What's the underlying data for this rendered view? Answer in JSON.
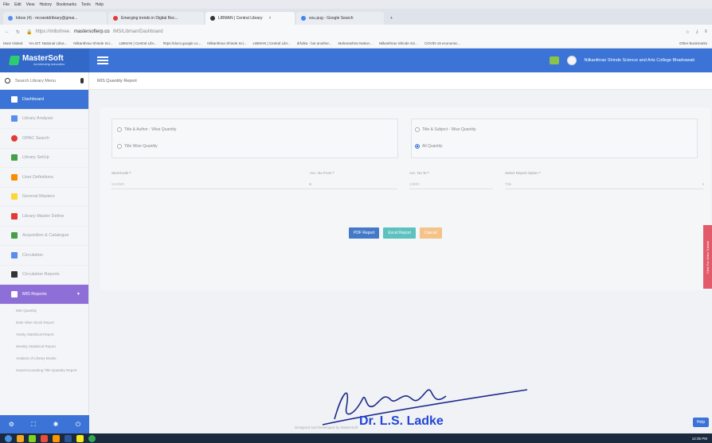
{
  "browser": {
    "menu": [
      "File",
      "Edit",
      "View",
      "History",
      "Bookmarks",
      "Tools",
      "Help"
    ],
    "tabs": [
      {
        "label": "Inbox (4) - mcoestdribrary@gmai...",
        "color": "#5b8def",
        "active": false
      },
      {
        "label": "Emerging trends in Digital Rec...",
        "color": "#e53935",
        "active": false
      },
      {
        "label": "LIBMAN | Central Library",
        "color": "#333333",
        "active": true
      },
      {
        "label": "sou.pug - Google Search",
        "color": "#4285f4",
        "active": false
      }
    ],
    "url_prefix": "https://mlbshree.",
    "url_host": "mastersofterp.co",
    "url_suffix": "/MS/Libman/Dashboard",
    "bookmarks": [
      "Most Visited",
      "N-LIST: National Libra...",
      "Nilkanthrao Shinde Sci...",
      "LIBMAN | Central Libr...",
      "https://docs.google.co...",
      "Nilkanthrao Shinde Sci...",
      "LIBMAN | Central Libr...",
      "drfulka - but another...",
      "Maharashtra Nation...",
      "Nilkanthrao Shinde Sci...",
      "COVID-19 economic..."
    ],
    "other_bookmarks": "Other Bookmarks"
  },
  "header": {
    "brand": "MasterSoft",
    "tagline": "Architecting education",
    "institution": "Nilkanthrao Shinde Science and Arts College Bhadrawati"
  },
  "sidebar": {
    "search_placeholder": "Search Library Menu",
    "items": [
      {
        "label": "Dashboard",
        "state": "active",
        "icon": "home-icon",
        "color": "#ffffff"
      },
      {
        "label": "Library Analysis",
        "state": "",
        "icon": "bar-chart-icon",
        "color": "#5b8def"
      },
      {
        "label": "OPAC Search",
        "state": "",
        "icon": "search-icon",
        "color": "#e53935"
      },
      {
        "label": "Library SetUp",
        "state": "",
        "icon": "gears-icon",
        "color": "#43a047"
      },
      {
        "label": "User Definitions",
        "state": "",
        "icon": "users-icon",
        "color": "#fb8c00"
      },
      {
        "label": "General Masters",
        "state": "",
        "icon": "pencil-icon",
        "color": "#fdd835"
      },
      {
        "label": "Library Master Define",
        "state": "",
        "icon": "group-icon",
        "color": "#e53935"
      },
      {
        "label": "Acquisition & Catalogue",
        "state": "",
        "icon": "leaf-icon",
        "color": "#43a047"
      },
      {
        "label": "Circulation",
        "state": "",
        "icon": "refresh-icon",
        "color": "#5b8def"
      },
      {
        "label": "Circulation Reports",
        "state": "",
        "icon": "book-icon",
        "color": "#333333"
      },
      {
        "label": "MIS Reports",
        "state": "open",
        "icon": "reports-icon",
        "color": "#ffffff"
      }
    ],
    "sub_items": [
      "MIS Quantity",
      "Date Wise Stock Report",
      "Yearly Statistical Report",
      "Weekly Statistical Report",
      "Analysis of Library Books",
      "Issue/Accounting Title Quantity Report"
    ]
  },
  "main": {
    "breadcrumb": "MIS Quantity Report",
    "radios": [
      {
        "label": "Title & Author - Wise Quantity",
        "checked": false
      },
      {
        "label": "Title Wise Quantity",
        "checked": false
      },
      {
        "label": "Title & Subject - Wise Quantity",
        "checked": false
      },
      {
        "label": "All Quantity",
        "checked": true
      }
    ],
    "fields": [
      {
        "label": "StoreCode",
        "value": "SAGMS"
      },
      {
        "label": "Acc. No From",
        "value": "1"
      },
      {
        "label": "Acc. No To",
        "value": "13900"
      },
      {
        "label": "Select Report Option",
        "value": "Title"
      }
    ],
    "buttons": {
      "pdf": "PDF Report",
      "excel": "Excel Report",
      "cancel": "Cancel"
    }
  },
  "side_tab": "Click For Video Tutorial",
  "help": "Help",
  "footer_note": "Designed and Developed by MasterSoft",
  "signature_name": "Dr. L.S. Ladke",
  "clock": "12:35 PM"
}
